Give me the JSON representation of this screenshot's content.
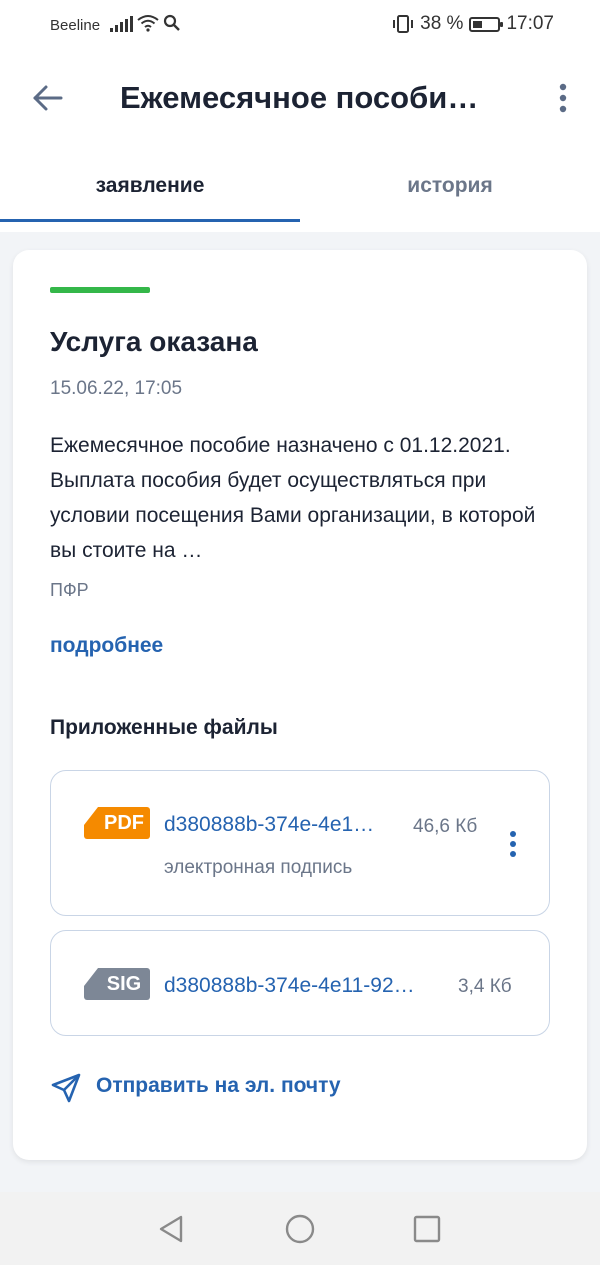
{
  "status_bar": {
    "carrier": "Beeline",
    "battery_percent": "38 %",
    "battery_level": 0.38,
    "time": "17:07",
    "icons": [
      "signal-icon",
      "wifi-icon",
      "search-icon",
      "vibrate-icon",
      "battery-icon"
    ]
  },
  "app_bar": {
    "title": "Ежемесячное пособи…",
    "back_icon": "arrow-left-icon",
    "menu_icon": "more-vertical-icon"
  },
  "tabs": [
    {
      "label": "заявление",
      "active": true
    },
    {
      "label": "история",
      "active": false
    }
  ],
  "colors": {
    "accent": "#2563b0",
    "success": "#34b749",
    "pdf_badge": "#f58a00",
    "sig_badge": "#7d8796",
    "text": "#1c2333",
    "muted": "#6b7689"
  },
  "card": {
    "status_title": "Услуга оказана",
    "status_date": "15.06.22, 17:05",
    "description": "Ежемесячное пособие назначено с 01.12.2021. Выплата пособия будет осуществляться при условии посещения Вами организации, в которой вы стоите на …",
    "organization": "ПФР",
    "more_link": "подробнее",
    "files_title": "Приложенные файлы",
    "files": [
      {
        "badge": "PDF",
        "name": "d380888b-374e-4e1…",
        "size": "46,6 Кб",
        "subtitle": "электронная подпись"
      },
      {
        "badge": "SIG",
        "name": "d380888b-374e-4e11-92…",
        "size": "3,4 Кб"
      }
    ],
    "send_email": "Отправить на эл. почту"
  },
  "nav_bar": {
    "buttons": [
      "back-triangle-icon",
      "home-circle-icon",
      "recents-square-icon"
    ]
  }
}
